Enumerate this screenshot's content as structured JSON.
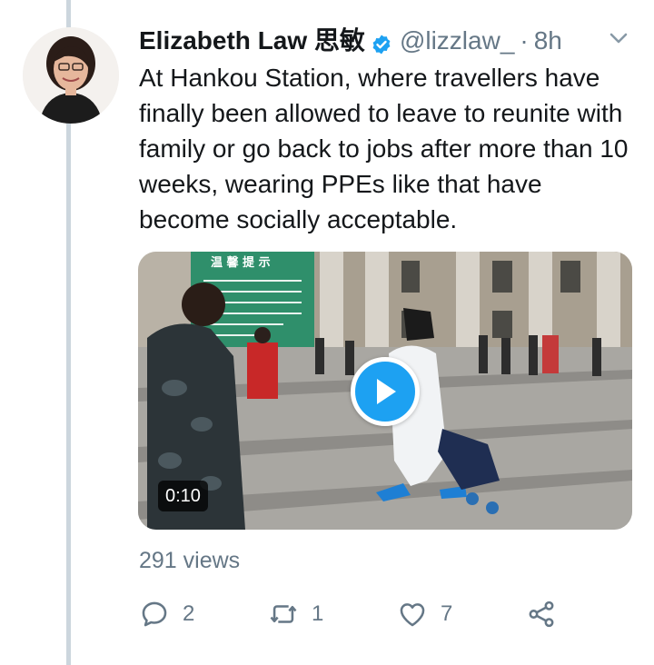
{
  "tweet": {
    "author_name": "Elizabeth Law 思敏",
    "handle": "@lizzlaw_",
    "separator": "·",
    "time": "8h",
    "text": "At Hankou Station, where travellers have finally been allowed to leave to reunite with family or go back to jobs after more than 10 weeks, wearing PPEs like that have become socially acceptable.",
    "media": {
      "type": "video",
      "duration": "0:10",
      "sign_text": "温 馨 提 示"
    },
    "views": "291 views",
    "actions": {
      "reply_count": "2",
      "retweet_count": "1",
      "like_count": "7"
    }
  },
  "colors": {
    "accent": "#1da1f2",
    "muted": "#657786",
    "text": "#14171a",
    "thread_line": "#ccd6dd"
  },
  "icons": [
    "verified-badge-icon",
    "chevron-down-icon",
    "play-icon",
    "reply-icon",
    "retweet-icon",
    "like-icon",
    "share-icon"
  ]
}
